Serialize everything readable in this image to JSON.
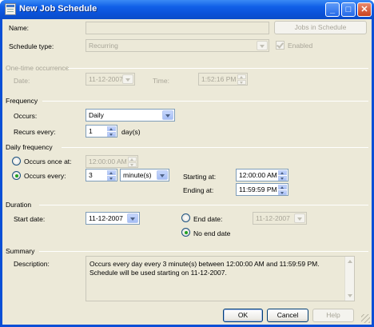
{
  "window": {
    "title": "New Job Schedule",
    "minimize": "_",
    "maximize": "□",
    "close": "✕"
  },
  "general": {
    "name_label": "Name:",
    "name_value": "",
    "jobs_button": "Jobs in Schedule",
    "schedule_type_label": "Schedule type:",
    "schedule_type_value": "Recurring",
    "enabled_label": "Enabled",
    "enabled_checked": true
  },
  "one_time": {
    "section_title": "One-time occurrence",
    "date_label": "Date:",
    "date_value": "11-12-2007",
    "time_label": "Time:",
    "time_value": "1:52:16 PM"
  },
  "frequency": {
    "section_title": "Frequency",
    "occurs_label": "Occurs:",
    "occurs_value": "Daily",
    "recurs_label": "Recurs every:",
    "recurs_value": "1",
    "recurs_unit": "day(s)"
  },
  "daily": {
    "section_title": "Daily frequency",
    "once_label": "Occurs once at:",
    "once_value": "12:00:00 AM",
    "every_label": "Occurs every:",
    "every_value": "3",
    "every_unit": "minute(s)",
    "selected": "every",
    "starting_label": "Starting at:",
    "starting_value": "12:00:00 AM",
    "ending_label": "Ending at:",
    "ending_value": "11:59:59 PM"
  },
  "duration": {
    "section_title": "Duration",
    "start_label": "Start date:",
    "start_value": "11-12-2007",
    "end_label": "End date:",
    "end_value": "11-12-2007",
    "no_end_label": "No end date",
    "selected": "no_end"
  },
  "summary": {
    "section_title": "Summary",
    "description_label": "Description:",
    "description_text": "Occurs every day every 3 minute(s) between 12:00:00 AM and 11:59:59 PM. Schedule will be used starting on 11-12-2007."
  },
  "buttons": {
    "ok": "OK",
    "cancel": "Cancel",
    "help": "Help"
  },
  "colors": {
    "titlebar": "#0a52d9",
    "face": "#ece9d8",
    "radio_dot": "#21a121"
  }
}
